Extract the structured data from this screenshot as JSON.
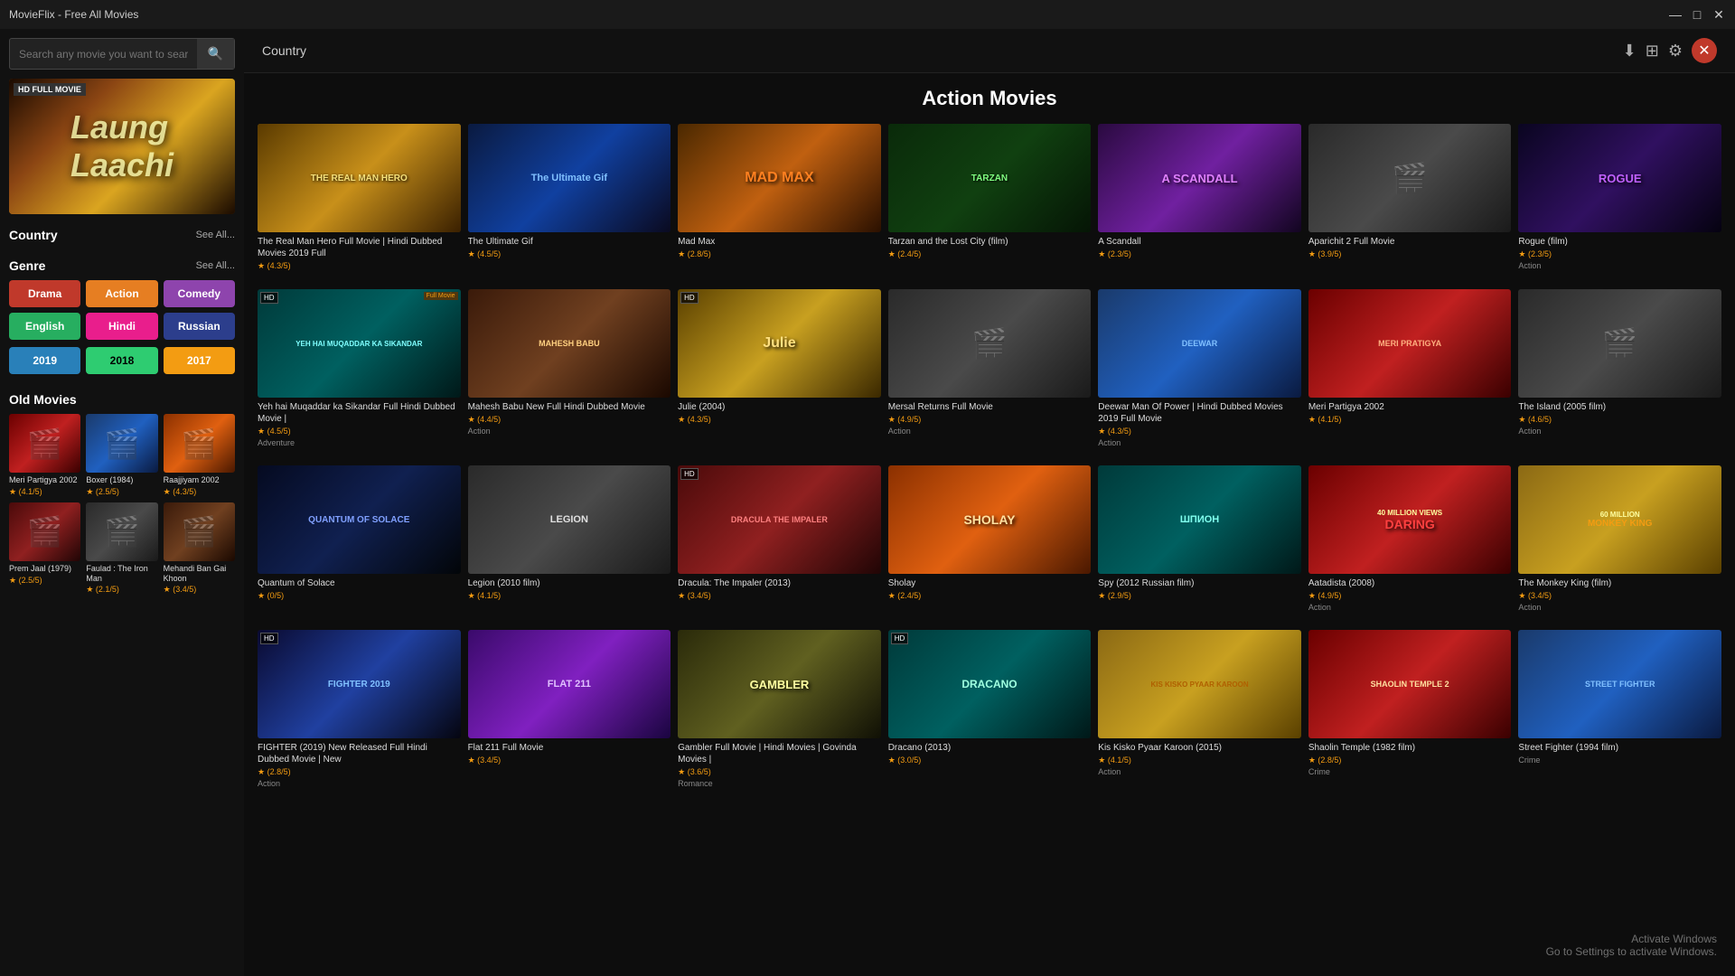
{
  "app": {
    "title": "MovieFlix - Free All Movies"
  },
  "titlebar": {
    "minimize": "—",
    "maximize": "□",
    "close": "✕"
  },
  "search": {
    "placeholder": "Search any movie you want to search"
  },
  "featured": {
    "badge": "HD FULL MOVIE",
    "title": "Laung Laachi"
  },
  "sidebar": {
    "country_label": "Country",
    "country_see_all": "See All...",
    "genre_label": "Genre",
    "genre_see_all": "See All...",
    "genres": [
      {
        "label": "Drama",
        "color": "btn-red"
      },
      {
        "label": "Action",
        "color": "btn-orange"
      },
      {
        "label": "Comedy",
        "color": "btn-purple"
      },
      {
        "label": "English",
        "color": "btn-green"
      },
      {
        "label": "Hindi",
        "color": "btn-pink"
      },
      {
        "label": "Russian",
        "color": "btn-darkblue"
      },
      {
        "label": "2019",
        "color": "year-blue"
      },
      {
        "label": "2018",
        "color": "year-darkgreen"
      },
      {
        "label": "2017",
        "color": "year-gold"
      }
    ],
    "old_movies_label": "Old Movies",
    "old_movies": [
      {
        "title": "Meri Partigya 2002",
        "rating": "(4.1/5)",
        "bg": "bg-red"
      },
      {
        "title": "Boxer (1984)",
        "rating": "(2.5/5)",
        "bg": "bg-blue"
      },
      {
        "title": "Raajjiyam 2002",
        "rating": "(4.3/5)",
        "bg": "bg-orange"
      },
      {
        "title": "Prem Jaal (1979)",
        "rating": "(2.5/5)",
        "bg": "bg-maroon"
      },
      {
        "title": "Faulad : The Iron Man",
        "rating": "(2.1/5)",
        "bg": "bg-gray"
      },
      {
        "title": "Mehandi Ban Gai Khoon",
        "rating": "(3.4/5)",
        "bg": "bg-brown"
      }
    ]
  },
  "topbar": {
    "country_label": "Country",
    "section_title": "Action Movies"
  },
  "movies": {
    "row1": [
      {
        "title": "The Real Man Hero Full Movie | Hindi Dubbed Movies 2019 Full",
        "rating": "(4.3/5)",
        "tag": "",
        "bg": "bg-yellow"
      },
      {
        "title": "The Ultimate Gif",
        "rating": "(4.5/5)",
        "tag": "",
        "bg": "bg-blue"
      },
      {
        "title": "Mad Max",
        "rating": "(2.8/5)",
        "tag": "",
        "bg": "bg-orange"
      },
      {
        "title": "Tarzan and the Lost City (film)",
        "rating": "(2.4/5)",
        "tag": "",
        "bg": "bg-green"
      },
      {
        "title": "A Scandall",
        "rating": "(2.3/5)",
        "tag": "",
        "bg": "bg-purple"
      },
      {
        "title": "Aparichit 2 Full Movie",
        "rating": "(3.9/5)",
        "tag": "",
        "bg": "bg-gray"
      },
      {
        "title": "Rogue (film)",
        "rating": "(2.3/5)",
        "tag": "Action",
        "bg": "bg-darkblue"
      }
    ],
    "row2": [
      {
        "title": "Yeh hai Muqaddar ka Sikandar Full Hindi Dubbed Movie |",
        "rating": "(4.5/5)",
        "tag": "Adventure",
        "bg": "bg-teal",
        "hd": true,
        "fm": true
      },
      {
        "title": "Mahesh Babu New Full Hindi Dubbed Movie",
        "rating": "(4.4/5)",
        "tag": "Action",
        "bg": "bg-brown"
      },
      {
        "title": "Julie (2004)",
        "rating": "(4.3/5)",
        "tag": "",
        "bg": "bg-yellow",
        "hd": true
      },
      {
        "title": "Mersal Returns Full Movie",
        "rating": "(4.9/5)",
        "tag": "Action",
        "bg": "bg-gray"
      },
      {
        "title": "Deewar Man Of Power | Hindi Dubbed Movies 2019 Full Movie",
        "rating": "(4.3/5)",
        "tag": "Action",
        "bg": "bg-blue"
      },
      {
        "title": "Meri Partigya 2002",
        "rating": "(4.1/5)",
        "tag": "",
        "bg": "bg-red"
      },
      {
        "title": "The Island (2005 film)",
        "rating": "(4.6/5)",
        "tag": "Action",
        "bg": "bg-gray"
      }
    ],
    "row3": [
      {
        "title": "Quantum of Solace",
        "rating": "(0/5)",
        "tag": "",
        "bg": "bg-darkblue"
      },
      {
        "title": "Legion (2010 film)",
        "rating": "(4.1/5)",
        "tag": "",
        "bg": "bg-gray"
      },
      {
        "title": "Dracula: The Impaler (2013)",
        "rating": "(3.4/5)",
        "tag": "",
        "bg": "bg-maroon",
        "hd": true
      },
      {
        "title": "Sholay",
        "rating": "(2.4/5)",
        "tag": "",
        "bg": "bg-orange"
      },
      {
        "title": "Spy (2012 Russian film)",
        "rating": "(2.9/5)",
        "tag": "",
        "bg": "bg-teal"
      },
      {
        "title": "Aatadista (2008)",
        "rating": "(4.9/5)",
        "tag": "Action",
        "bg": "bg-red"
      },
      {
        "title": "The Monkey King (film)",
        "rating": "(3.4/5)",
        "tag": "Action",
        "bg": "bg-yellow"
      }
    ],
    "row4": [
      {
        "title": "FIGHTER (2019) New Released Full Hindi Dubbed Movie | New",
        "rating": "(2.8/5)",
        "tag": "Action",
        "bg": "bg-blue",
        "hd": true
      },
      {
        "title": "Flat 211 Full Movie",
        "rating": "(3.4/5)",
        "tag": "",
        "bg": "bg-purple"
      },
      {
        "title": "Gambler Full Movie | Hindi Movies | Govinda Movies |",
        "rating": "(3.6/5)",
        "tag": "Romance",
        "bg": "bg-olive"
      },
      {
        "title": "Dracano (2013)",
        "rating": "(3.0/5)",
        "tag": "",
        "bg": "bg-teal",
        "hd": true
      },
      {
        "title": "Kis Kisko Pyaar Karoon (2015)",
        "rating": "(4.1/5)",
        "tag": "Action",
        "bg": "bg-yellow"
      },
      {
        "title": "Shaolin Temple (1982 film)",
        "rating": "(2.8/5)",
        "tag": "Crime",
        "bg": "bg-red"
      },
      {
        "title": "Street Fighter (1994 film)",
        "rating": "",
        "tag": "Crime",
        "bg": "bg-blue"
      }
    ]
  },
  "activate_windows": {
    "line1": "Activate Windows",
    "line2": "Go to Settings to activate Windows."
  }
}
